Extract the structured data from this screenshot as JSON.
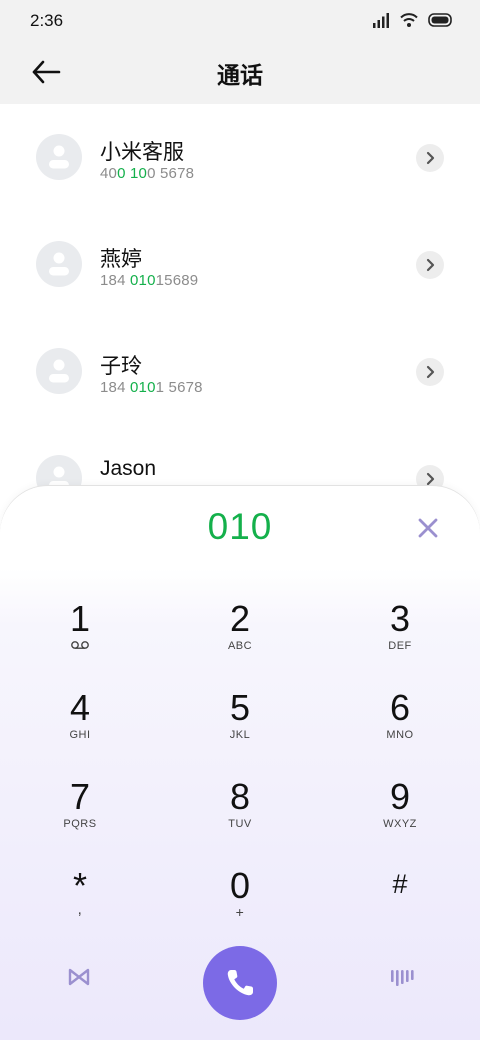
{
  "status": {
    "time": "2:36",
    "icons": [
      "signal-icon",
      "wifi-icon",
      "battery-icon"
    ]
  },
  "header": {
    "title": "通话",
    "back_icon": "arrow-left-icon"
  },
  "contacts": [
    {
      "name": "小米客服",
      "number_parts": [
        [
          "40",
          false
        ],
        [
          "0",
          true
        ],
        [
          " ",
          false
        ],
        [
          "10",
          true
        ],
        [
          "0 5678",
          false
        ]
      ]
    },
    {
      "name": "燕婷",
      "number_parts": [
        [
          "184 ",
          false
        ],
        [
          "010",
          true
        ],
        [
          "15689",
          false
        ]
      ]
    },
    {
      "name": "子玲",
      "number_parts": [
        [
          "184 ",
          false
        ],
        [
          "010",
          true
        ],
        [
          "1 5678",
          false
        ]
      ]
    },
    {
      "name": "Jason",
      "number_parts": []
    }
  ],
  "dialer": {
    "input_value": "010",
    "keys": [
      {
        "digit": "1",
        "letters": ""
      },
      {
        "digit": "2",
        "letters": "ABC"
      },
      {
        "digit": "3",
        "letters": "DEF"
      },
      {
        "digit": "4",
        "letters": "GHI"
      },
      {
        "digit": "5",
        "letters": "JKL"
      },
      {
        "digit": "6",
        "letters": "MNO"
      },
      {
        "digit": "7",
        "letters": "PQRS"
      },
      {
        "digit": "8",
        "letters": "TUV"
      },
      {
        "digit": "9",
        "letters": "WXYZ"
      },
      {
        "digit": "*",
        "letters": ","
      },
      {
        "digit": "0",
        "letters": "+"
      },
      {
        "digit": "#",
        "letters": ""
      }
    ]
  },
  "colors": {
    "highlight": "#14b04b",
    "accent": "#7c6ae6",
    "icon_muted": "#9b90cf"
  }
}
